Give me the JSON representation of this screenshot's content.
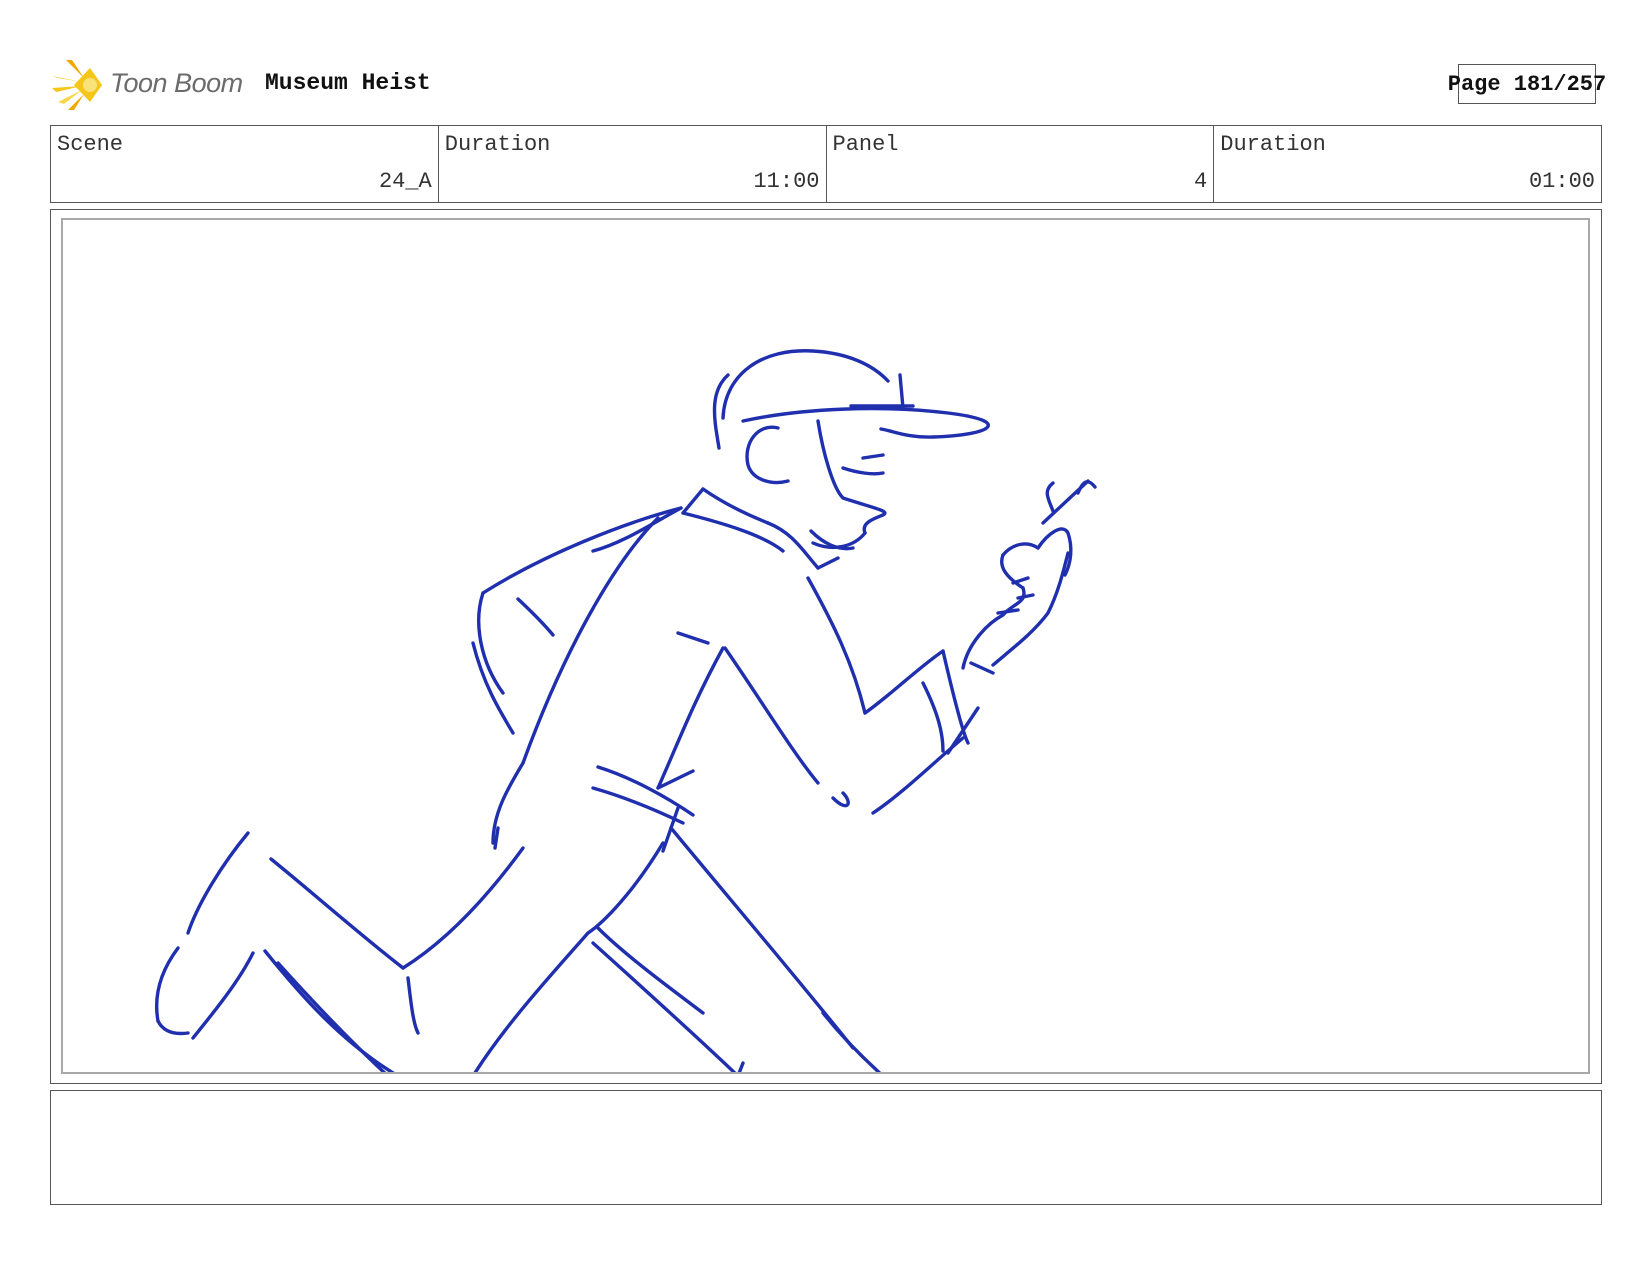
{
  "header": {
    "logo_text": "Toon Boom",
    "project_title": "Museum Heist",
    "page_label": "Page 181/257"
  },
  "info": {
    "scene_label": "Scene",
    "scene_value": "24_A",
    "scene_duration_label": "Duration",
    "scene_duration_value": "11:00",
    "panel_label": "Panel",
    "panel_value": "4",
    "panel_duration_label": "Duration",
    "panel_duration_value": "01:00"
  },
  "colors": {
    "sketch_stroke": "#1f2fae",
    "logo_star": "#f5c518",
    "border": "#555555"
  },
  "icons": {
    "logo": "toon-boom-star-icon"
  }
}
